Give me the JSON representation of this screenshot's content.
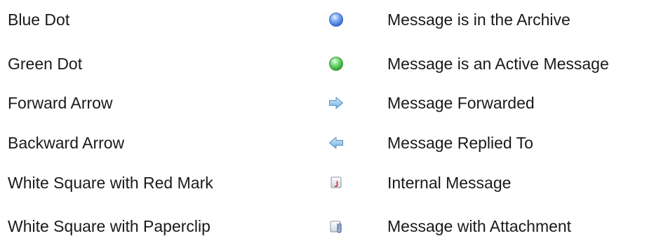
{
  "legend": {
    "rows": [
      {
        "name": "Blue Dot",
        "icon": "blue-dot-icon",
        "meaning": "Message is in the Archive"
      },
      {
        "name": "Green Dot",
        "icon": "green-dot-icon",
        "meaning": "Message is an Active Message"
      },
      {
        "name": "Forward Arrow",
        "icon": "forward-arrow-icon",
        "meaning": "Message Forwarded"
      },
      {
        "name": "Backward Arrow",
        "icon": "backward-arrow-icon",
        "meaning": "Message Replied To"
      },
      {
        "name": "White Square with Red Mark",
        "icon": "white-square-red-mark-icon",
        "meaning": "Internal Message"
      },
      {
        "name": "White Square with Paperclip",
        "icon": "white-square-paperclip-icon",
        "meaning": "Message with Attachment"
      }
    ]
  },
  "colors": {
    "text": "#1a1a1a",
    "blue_dot": "#4f8cf0",
    "green_dot": "#4cc84c",
    "arrow_fill": "#8fc3ea",
    "mark_red": "#d22020",
    "paperclip": "#5577aa"
  }
}
